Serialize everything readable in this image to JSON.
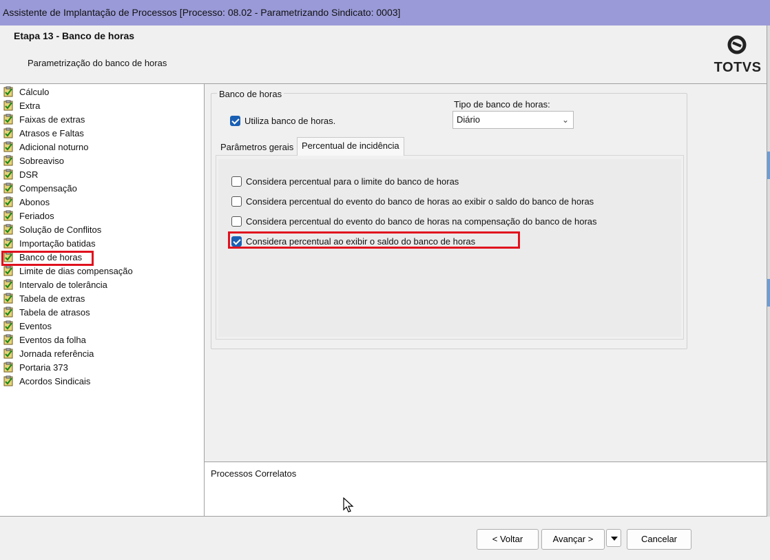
{
  "window": {
    "title": "Assistente de Implantação de Processos [Processo: 08.02 - Parametrizando Sindicato: 0003]"
  },
  "header": {
    "step_title": "Etapa 13 - Banco de horas",
    "step_subtitle": "Parametrização do banco de horas",
    "logo_text": "TOTVS"
  },
  "sidebar": {
    "items": [
      {
        "label": "Cálculo"
      },
      {
        "label": "Extra"
      },
      {
        "label": "Faixas de extras"
      },
      {
        "label": "Atrasos e Faltas"
      },
      {
        "label": "Adicional noturno"
      },
      {
        "label": "Sobreaviso"
      },
      {
        "label": "DSR"
      },
      {
        "label": "Compensação"
      },
      {
        "label": "Abonos"
      },
      {
        "label": "Feriados"
      },
      {
        "label": "Solução de Conflitos"
      },
      {
        "label": "Importação batidas"
      },
      {
        "label": "Banco de horas",
        "selected": true
      },
      {
        "label": "Limite de dias compensação"
      },
      {
        "label": "Intervalo de tolerância"
      },
      {
        "label": "Tabela de extras"
      },
      {
        "label": "Tabela de atrasos"
      },
      {
        "label": "Eventos"
      },
      {
        "label": "Eventos da folha"
      },
      {
        "label": "Jornada referência"
      },
      {
        "label": "Portaria 373"
      },
      {
        "label": "Acordos Sindicais"
      }
    ],
    "item_icon": "checked-clipboard-icon"
  },
  "main": {
    "group_title": "Banco de horas",
    "use_bank": {
      "label": "Utiliza banco de horas.",
      "checked": true
    },
    "type": {
      "label": "Tipo de banco de horas:",
      "value": "Diário"
    },
    "tabs": [
      {
        "label": "Parâmetros gerais",
        "active": false
      },
      {
        "label": "Percentual de incidência",
        "active": true
      }
    ],
    "options": [
      {
        "label": "Considera percentual para o limite do banco de horas",
        "checked": false
      },
      {
        "label": "Considera percentual do evento do banco de horas ao exibir o saldo do banco de horas",
        "checked": false
      },
      {
        "label": "Considera percentual do evento do banco de horas na compensação do banco de horas",
        "checked": false
      },
      {
        "label": "Considera percentual ao exibir o saldo do banco de horas",
        "checked": true
      }
    ]
  },
  "related": {
    "title": "Processos Correlatos"
  },
  "footer": {
    "back_label": "< Voltar",
    "next_label": "Avançar >",
    "cancel_label": "Cancelar"
  },
  "colors": {
    "titlebar": "#9a9ad8",
    "highlight": "#e0111e",
    "checkbox_checked": "#1a5fb4"
  }
}
